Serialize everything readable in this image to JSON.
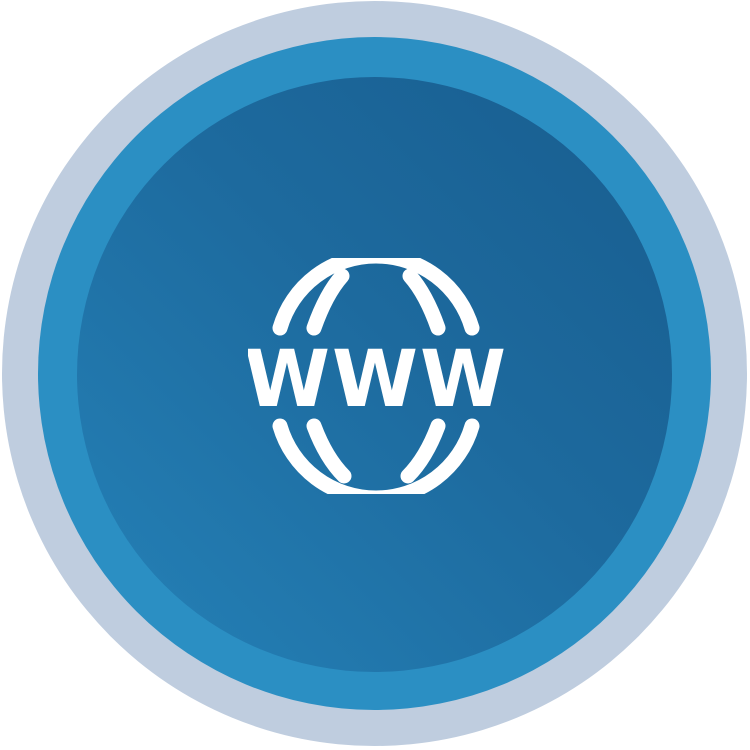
{
  "icon": {
    "name": "globe-www-icon",
    "text": "WWW"
  },
  "colors": {
    "outer_ring": "#bfcddf",
    "middle_ring": "#2b8fc3",
    "inner_disc_dark": "#185d8f",
    "inner_disc_light": "#2582b8",
    "glyph": "#ffffff"
  }
}
